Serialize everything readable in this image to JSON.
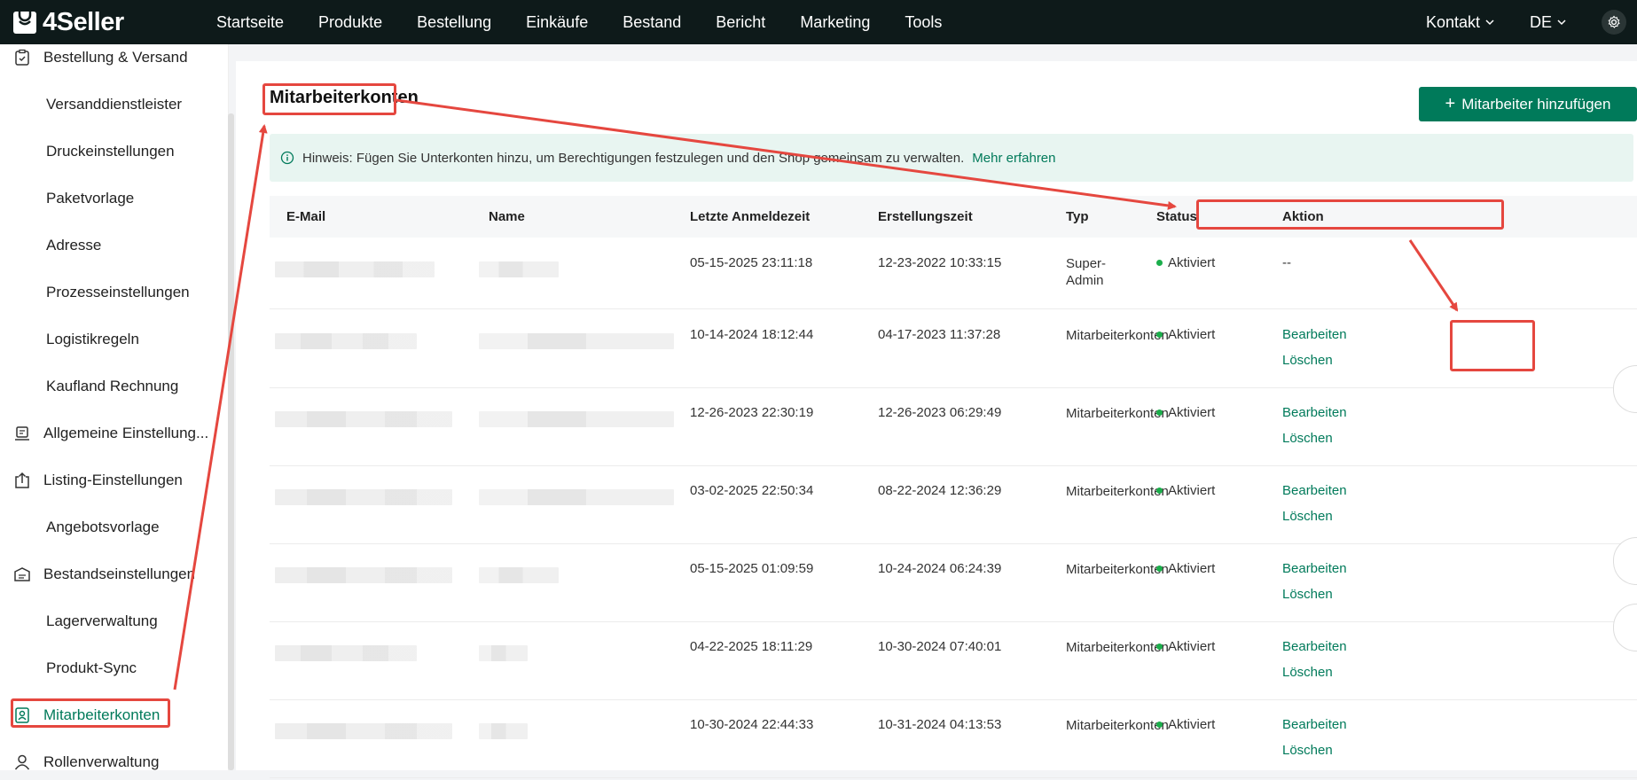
{
  "app": {
    "name": "4Seller",
    "accent": "#007a5a",
    "highlight": "#e5473f"
  },
  "nav": [
    {
      "label": "Startseite"
    },
    {
      "label": "Produkte"
    },
    {
      "label": "Bestellung"
    },
    {
      "label": "Einkäufe"
    },
    {
      "label": "Bestand"
    },
    {
      "label": "Bericht"
    },
    {
      "label": "Marketing"
    },
    {
      "label": "Tools"
    }
  ],
  "top_right": {
    "contact": "Kontakt",
    "language": "DE",
    "settings_icon": "gear-icon"
  },
  "sidebar": {
    "items": [
      {
        "label": "Bestellung & Versand",
        "type": "top",
        "icon": "clipboard-check-icon"
      },
      {
        "label": "Versanddienstleister",
        "type": "sub"
      },
      {
        "label": "Druckeinstellungen",
        "type": "sub"
      },
      {
        "label": "Paketvorlage",
        "type": "sub"
      },
      {
        "label": "Adresse",
        "type": "sub"
      },
      {
        "label": "Prozesseinstellungen",
        "type": "sub"
      },
      {
        "label": "Logistikregeln",
        "type": "sub"
      },
      {
        "label": "Kaufland Rechnung",
        "type": "sub"
      },
      {
        "label": "Allgemeine Einstellung...",
        "type": "top",
        "icon": "device-icon"
      },
      {
        "label": "Listing-Einstellungen",
        "type": "top",
        "icon": "upload-box-icon"
      },
      {
        "label": "Angebotsvorlage",
        "type": "sub"
      },
      {
        "label": "Bestandseinstellungen",
        "type": "top",
        "icon": "inventory-icon"
      },
      {
        "label": "Lagerverwaltung",
        "type": "sub"
      },
      {
        "label": "Produkt-Sync",
        "type": "sub"
      },
      {
        "label": "Mitarbeiterkonten",
        "type": "top",
        "icon": "staff-badge-icon",
        "active": true
      },
      {
        "label": "Rollenverwaltung",
        "type": "top",
        "icon": "user-icon"
      }
    ]
  },
  "page": {
    "title": "Mitarbeiterkonten",
    "add_button": "Mitarbeiter hinzufügen",
    "notice": "Hinweis: Fügen Sie Unterkonten hinzu, um Berechtigungen festzulegen und den Shop gemeinsam zu verwalten.",
    "notice_link": "Mehr erfahren"
  },
  "table": {
    "columns": [
      "E-Mail",
      "Name",
      "Letzte Anmeldezeit",
      "Erstellungszeit",
      "Typ",
      "Status",
      "Aktion"
    ],
    "rows": [
      {
        "last_login": "05-15-2025 23:11:18",
        "created": "12-23-2022 10:33:15",
        "type": "Super-Admin",
        "status": "Aktiviert",
        "actions": [
          "--"
        ]
      },
      {
        "last_login": "10-14-2024 18:12:44",
        "created": "04-17-2023 11:37:28",
        "type": "Mitarbeiterkonten",
        "status": "Aktiviert",
        "actions": [
          "Bearbeiten",
          "Löschen"
        ]
      },
      {
        "last_login": "12-26-2023 22:30:19",
        "created": "12-26-2023 06:29:49",
        "type": "Mitarbeiterkonten",
        "status": "Aktiviert",
        "actions": [
          "Bearbeiten",
          "Löschen"
        ]
      },
      {
        "last_login": "03-02-2025 22:50:34",
        "created": "08-22-2024 12:36:29",
        "type": "Mitarbeiterkonten",
        "status": "Aktiviert",
        "actions": [
          "Bearbeiten",
          "Löschen"
        ]
      },
      {
        "last_login": "05-15-2025 01:09:59",
        "created": "10-24-2024 06:24:39",
        "type": "Mitarbeiterkonten",
        "status": "Aktiviert",
        "actions": [
          "Bearbeiten",
          "Löschen"
        ]
      },
      {
        "last_login": "04-22-2025 18:11:29",
        "created": "10-30-2024 07:40:01",
        "type": "Mitarbeiterkonten",
        "status": "Aktiviert",
        "actions": [
          "Bearbeiten",
          "Löschen"
        ]
      },
      {
        "last_login": "10-30-2024 22:44:33",
        "created": "10-31-2024 04:13:53",
        "type": "Mitarbeiterkonten",
        "status": "Aktiviert",
        "actions": [
          "Bearbeiten",
          "Löschen"
        ]
      }
    ]
  }
}
